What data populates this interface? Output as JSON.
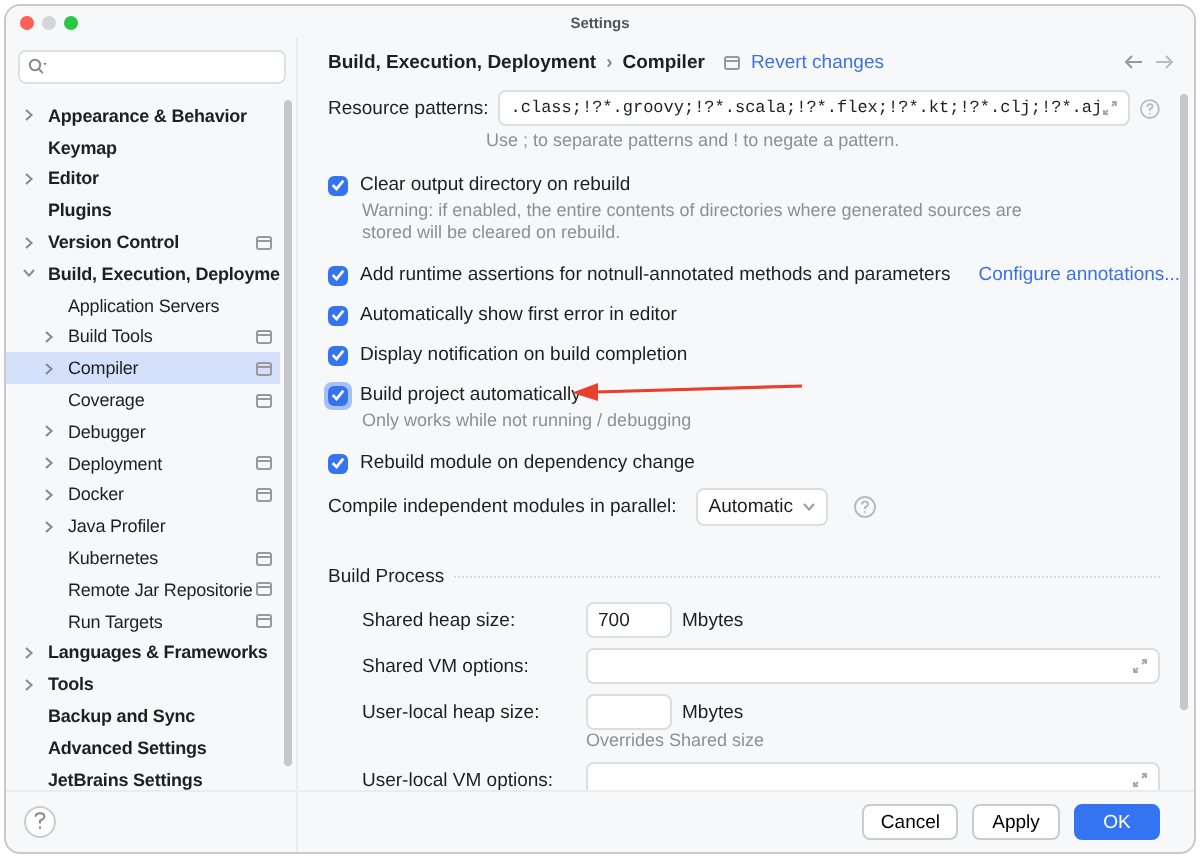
{
  "window": {
    "title": "Settings"
  },
  "sidebar": {
    "items": [
      {
        "label": "Appearance & Behavior",
        "kind": "folder",
        "expanded": false,
        "selected": false,
        "project_scope": false
      },
      {
        "label": "Keymap",
        "kind": "leaf",
        "selected": false,
        "project_scope": false
      },
      {
        "label": "Editor",
        "kind": "folder",
        "expanded": false,
        "selected": false,
        "project_scope": false
      },
      {
        "label": "Plugins",
        "kind": "leaf",
        "selected": false,
        "project_scope": false
      },
      {
        "label": "Version Control",
        "kind": "folder",
        "expanded": false,
        "selected": false,
        "project_scope": true
      },
      {
        "label": "Build, Execution, Deployme",
        "kind": "folder",
        "expanded": true,
        "selected": false,
        "project_scope": false,
        "children": [
          {
            "label": "Application Servers",
            "kind": "leaf",
            "selected": false,
            "project_scope": false
          },
          {
            "label": "Build Tools",
            "kind": "folder",
            "expanded": false,
            "selected": false,
            "project_scope": true
          },
          {
            "label": "Compiler",
            "kind": "folder",
            "expanded": false,
            "selected": true,
            "project_scope": true
          },
          {
            "label": "Coverage",
            "kind": "leaf",
            "selected": false,
            "project_scope": true
          },
          {
            "label": "Debugger",
            "kind": "folder",
            "expanded": false,
            "selected": false,
            "project_scope": false
          },
          {
            "label": "Deployment",
            "kind": "folder",
            "expanded": false,
            "selected": false,
            "project_scope": true
          },
          {
            "label": "Docker",
            "kind": "folder",
            "expanded": false,
            "selected": false,
            "project_scope": true
          },
          {
            "label": "Java Profiler",
            "kind": "folder",
            "expanded": false,
            "selected": false,
            "project_scope": false
          },
          {
            "label": "Kubernetes",
            "kind": "leaf",
            "selected": false,
            "project_scope": true
          },
          {
            "label": "Remote Jar Repositorie",
            "kind": "leaf",
            "selected": false,
            "project_scope": true
          },
          {
            "label": "Run Targets",
            "kind": "leaf",
            "selected": false,
            "project_scope": true
          }
        ]
      },
      {
        "label": "Languages & Frameworks",
        "kind": "folder",
        "expanded": false,
        "selected": false,
        "project_scope": false
      },
      {
        "label": "Tools",
        "kind": "folder",
        "expanded": false,
        "selected": false,
        "project_scope": false
      },
      {
        "label": "Backup and Sync",
        "kind": "leaf",
        "selected": false,
        "project_scope": false
      },
      {
        "label": "Advanced Settings",
        "kind": "leaf",
        "selected": false,
        "project_scope": false
      },
      {
        "label": "JetBrains Settings",
        "kind": "leaf",
        "selected": false,
        "project_scope": false
      }
    ]
  },
  "breadcrumb": {
    "parent": "Build, Execution, Deployment",
    "separator": "›",
    "current": "Compiler",
    "revert": "Revert changes"
  },
  "resource_patterns": {
    "label": "Resource patterns:",
    "value": ".class;!?*.groovy;!?*.scala;!?*.flex;!?*.kt;!?*.clj;!?*.aj",
    "hint": "Use ; to separate patterns and ! to negate a pattern."
  },
  "options": [
    {
      "label": "Clear output directory on rebuild",
      "checked": true,
      "focused": false,
      "note": "Warning: if enabled, the entire contents of directories where generated sources are stored will be cleared on rebuild."
    },
    {
      "label": "Add runtime assertions for notnull-annotated methods and parameters",
      "checked": true,
      "focused": false,
      "link": "Configure annotations..."
    },
    {
      "label": "Automatically show first error in editor",
      "checked": true,
      "focused": false
    },
    {
      "label": "Display notification on build completion",
      "checked": true,
      "focused": false
    },
    {
      "label": "Build project automatically",
      "checked": true,
      "focused": true,
      "note": "Only works while not running / debugging"
    },
    {
      "label": "Rebuild module on dependency change",
      "checked": true,
      "focused": false
    }
  ],
  "parallel": {
    "label": "Compile independent modules in parallel:",
    "value": "Automatic"
  },
  "build_process": {
    "title": "Build Process",
    "fields": [
      {
        "label": "Shared heap size:",
        "kind": "number",
        "value": "700",
        "unit": "Mbytes"
      },
      {
        "label": "Shared VM options:",
        "kind": "text"
      },
      {
        "label": "User-local heap size:",
        "kind": "number",
        "unit": "Mbytes",
        "hint": "Overrides Shared size"
      },
      {
        "label": "User-local VM options:",
        "kind": "text"
      }
    ]
  },
  "buttons": [
    {
      "label": "Cancel",
      "primary": false
    },
    {
      "label": "Apply",
      "primary": false
    },
    {
      "label": "OK",
      "primary": true
    }
  ]
}
